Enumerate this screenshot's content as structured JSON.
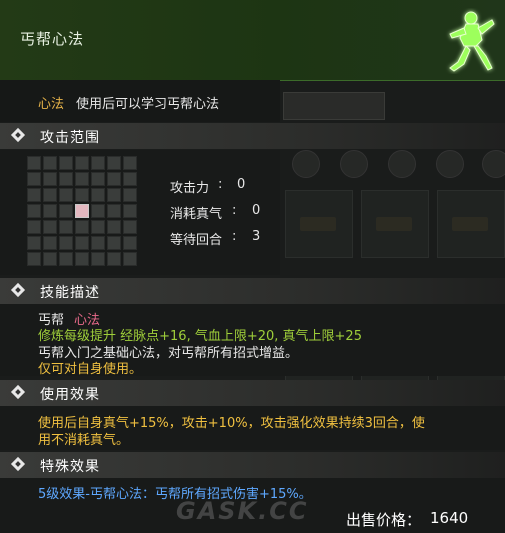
{
  "title": "丐帮心法",
  "subtitle": {
    "category": "心法",
    "text": "使用后可以学习丐帮心法"
  },
  "sections": {
    "range": {
      "title": "攻击范围"
    },
    "skill": {
      "title": "技能描述"
    },
    "use": {
      "title": "使用效果"
    },
    "special": {
      "title": "特殊效果"
    }
  },
  "stats": [
    {
      "label": "攻击力",
      "value": "0"
    },
    {
      "label": "消耗真气",
      "value": "0"
    },
    {
      "label": "等待回合",
      "value": "3"
    }
  ],
  "skill_desc": {
    "sect": "丐帮",
    "type": "心法",
    "levelup": "修炼每级提升 经脉点+16, 气血上限+20, 真气上限+25",
    "line1": "丐帮入门之基础心法，对丐帮所有招式增益。",
    "line2": "仅可对自身使用。"
  },
  "use_effect": {
    "line1": "使用后自身真气+15%，攻击+10%，攻击强化效果持续3回合，使",
    "line2": "用不消耗真气。"
  },
  "special_effect": "5级效果-丐帮心法：丐帮所有招式伤害+15%。",
  "price": {
    "label": "出售价格：",
    "value": "1640"
  },
  "watermark": "GASK.CC",
  "colors": {
    "title_bar": "#233a16",
    "green_text": "#9fcf3a",
    "blue_text": "#5ea8ff",
    "pink_text": "#e86a8a",
    "gold_text": "#e8b44a"
  }
}
